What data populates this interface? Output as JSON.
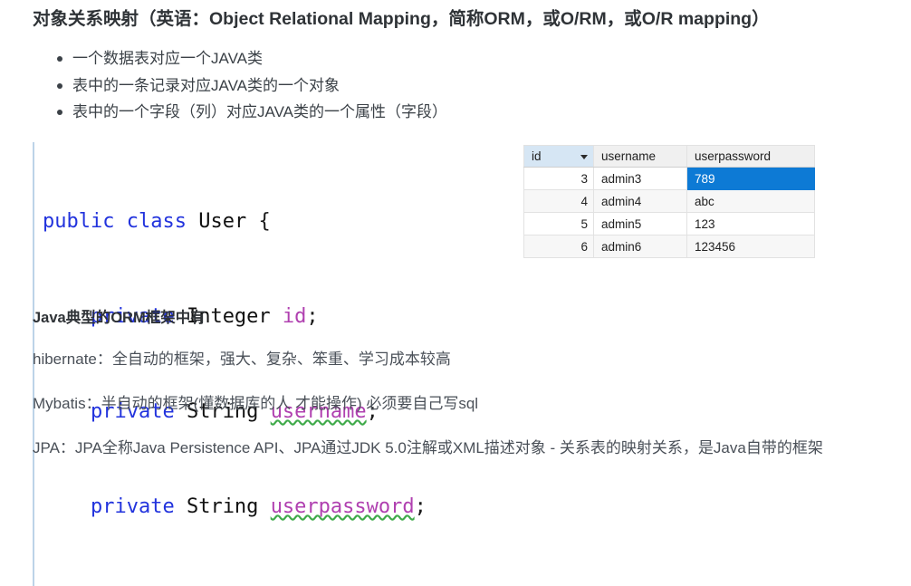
{
  "heading": {
    "text": "对象关系映射（英语：Object Relational Mapping，简称ORM，或O/RM，或O/R mapping）"
  },
  "bullets": [
    {
      "text": "一个数据表对应一个JAVA类"
    },
    {
      "text": "表中的一条记录对应JAVA类的一个对象"
    },
    {
      "text": "表中的一个字段（列）对应JAVA类的一个属性（字段）"
    }
  ],
  "code": {
    "language": "java",
    "line1_kw": "public class",
    "line1_type": "User",
    "line1_brace": "{",
    "line2_kw": "private",
    "line2_type": "Integer",
    "line2_ident": "id",
    "line2_semi": ";",
    "line3_kw": "private",
    "line3_type": "String",
    "line3_ident": "username",
    "line3_semi": ";",
    "line4_kw": "private",
    "line4_type": "String",
    "line4_ident": "userpassword",
    "line4_semi": ";"
  },
  "grid": {
    "columns": [
      "id",
      "username",
      "userpassword"
    ],
    "rows": [
      {
        "id": "3",
        "username": "admin3",
        "userpassword": "789"
      },
      {
        "id": "4",
        "username": "admin4",
        "userpassword": "abc"
      },
      {
        "id": "5",
        "username": "admin5",
        "userpassword": "123"
      },
      {
        "id": "6",
        "username": "admin6",
        "userpassword": "123456"
      }
    ],
    "selected_cell": "789",
    "selection_color": "#0d7ad5",
    "id_header_color": "#d6e6f4"
  },
  "subheading": {
    "text": "Java典型的ORM框架中有"
  },
  "paragraphs": {
    "hibernate": "hibernate：全自动的框架，强大、复杂、笨重、学习成本较高",
    "mybatis": "Mybatis：半自动的框架(懂数据库的人 才能操作) 必须要自己写sql",
    "jpa": "JPA：JPA全称Java Persistence API、JPA通过JDK 5.0注解或XML描述对象 - 关系表的映射关系，是Java自带的框架"
  }
}
